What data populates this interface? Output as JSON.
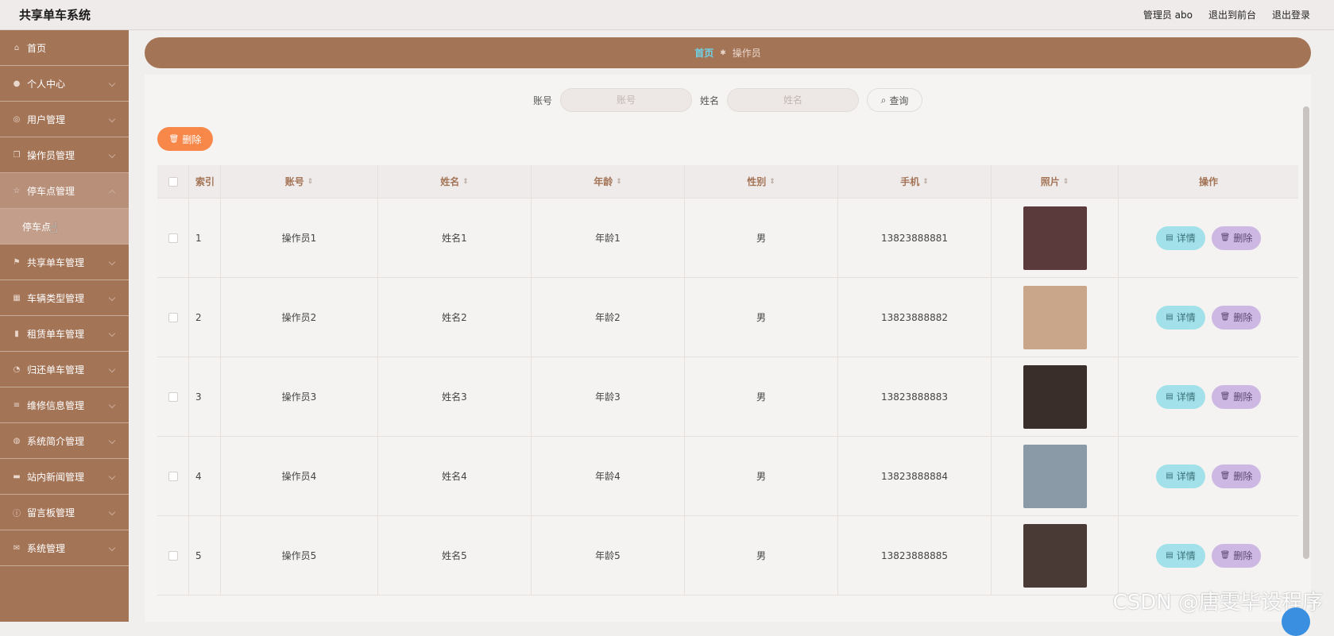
{
  "header": {
    "title": "共享单车系统",
    "user": "管理员 abo",
    "to_front": "退出到前台",
    "logout": "退出登录"
  },
  "sidebar": {
    "items": [
      {
        "label": "首页",
        "icon": "home-icon",
        "glyph": "⌂",
        "has_chevron": false
      },
      {
        "label": "个人中心",
        "icon": "user-icon",
        "glyph": "●",
        "has_chevron": true
      },
      {
        "label": "用户管理",
        "icon": "globe-icon",
        "glyph": "◎",
        "has_chevron": true
      },
      {
        "label": "操作员管理",
        "icon": "copy-icon",
        "glyph": "❐",
        "has_chevron": true
      },
      {
        "label": "停车点管理",
        "icon": "star-icon",
        "glyph": "☆",
        "has_chevron": true,
        "active": true
      }
    ],
    "sub_item": "停车点",
    "items_after": [
      {
        "label": "共享单车管理",
        "icon": "flag-icon",
        "glyph": "⚑"
      },
      {
        "label": "车辆类型管理",
        "icon": "grid-icon",
        "glyph": "▦"
      },
      {
        "label": "租赁单车管理",
        "icon": "bar-chart-icon",
        "glyph": "▮"
      },
      {
        "label": "归还单车管理",
        "icon": "clock-icon",
        "glyph": "◔"
      },
      {
        "label": "维修信息管理",
        "icon": "list-icon",
        "glyph": "≡"
      },
      {
        "label": "系统简介管理",
        "icon": "mic-icon",
        "glyph": "◍"
      },
      {
        "label": "站内新闻管理",
        "icon": "monitor-icon",
        "glyph": "▬"
      },
      {
        "label": "留言板管理",
        "icon": "info-icon",
        "glyph": "ⓘ"
      },
      {
        "label": "系统管理",
        "icon": "mail-icon",
        "glyph": "✉"
      }
    ]
  },
  "breadcrumb": {
    "home": "首页",
    "current": "操作员"
  },
  "search": {
    "account_label": "账号",
    "account_placeholder": "账号",
    "name_label": "姓名",
    "name_placeholder": "姓名",
    "query_button": "查询"
  },
  "toolbar": {
    "delete_label": "删除"
  },
  "table": {
    "headers": {
      "index": "索引",
      "account": "账号",
      "name": "姓名",
      "age": "年龄",
      "sex": "性别",
      "phone": "手机",
      "photo": "照片",
      "operation": "操作"
    },
    "detail_label": "详情",
    "delete_label": "删除",
    "rows": [
      {
        "index": "1",
        "account": "操作员1",
        "name": "姓名1",
        "age": "年龄1",
        "sex": "男",
        "phone": "13823888881",
        "photo_color": "#5a3a3a"
      },
      {
        "index": "2",
        "account": "操作员2",
        "name": "姓名2",
        "age": "年龄2",
        "sex": "男",
        "phone": "13823888882",
        "photo_color": "#c9a58a"
      },
      {
        "index": "3",
        "account": "操作员3",
        "name": "姓名3",
        "age": "年龄3",
        "sex": "男",
        "phone": "13823888883",
        "photo_color": "#3a2e2a"
      },
      {
        "index": "4",
        "account": "操作员4",
        "name": "姓名4",
        "age": "年龄4",
        "sex": "男",
        "phone": "13823888884",
        "photo_color": "#8a9aa6"
      },
      {
        "index": "5",
        "account": "操作员5",
        "name": "姓名5",
        "age": "年龄5",
        "sex": "男",
        "phone": "13823888885",
        "photo_color": "#4a3a36"
      }
    ]
  },
  "watermark": "CSDN @唐雯毕设程序"
}
